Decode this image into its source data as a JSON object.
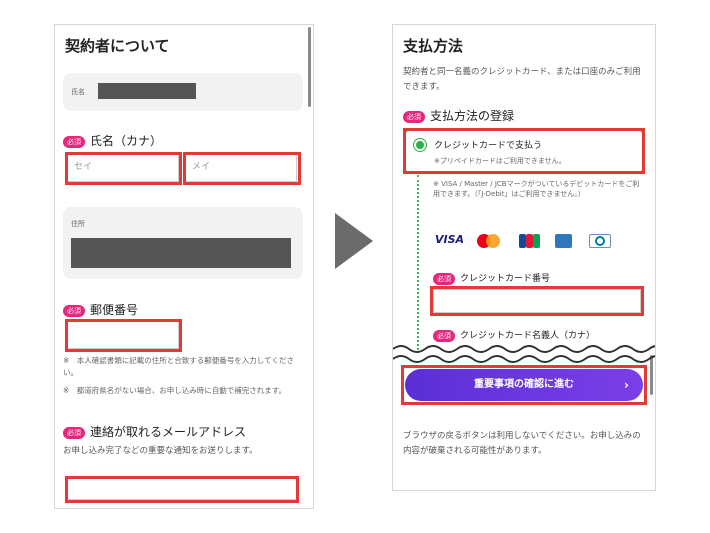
{
  "left": {
    "title": "契約者について",
    "name_label": "氏名",
    "required_badge": "必須",
    "kana_label": "氏名（カナ）",
    "sei_placeholder": "セイ",
    "mei_placeholder": "メイ",
    "address_label": "住所",
    "postal_label": "郵便番号",
    "postal_note1": "※　本人確認書類に記載の住所と合致する郵便番号を入力してください。",
    "postal_note2": "※　都道府県名がない場合、お申し込み時に自動で補完されます。",
    "email_label": "連絡が取れるメールアドレス",
    "email_desc": "お申し込み完了などの重要な通知をお送りします。"
  },
  "right": {
    "title": "支払方法",
    "desc": "契約者と同一名義のクレジットカード、または口座のみご利用できます。",
    "required_badge": "必須",
    "register_label": "支払方法の登録",
    "option_label": "クレジットカードで支払う",
    "option_note": "※プリペイドカードはご利用できません。",
    "debit_note": "※ VISA / Master / JCBマークがついているデビットカードをご利用できます。（「J-Debit」はご利用できません。）",
    "card_logos": [
      "VISA",
      "Mastercard",
      "JCB",
      "AMEX",
      "Diners Club"
    ],
    "card_number_label": "クレジットカード番号",
    "card_holder_label": "クレジットカード名義人（カナ）",
    "cta_label": "重要事項の確認に進む",
    "footer_note": "ブラウザの戻るボタンは利用しないでください。お申し込みの内容が破棄される可能性があります。"
  },
  "colors": {
    "highlight": "#e53935",
    "required": "#e8267c",
    "cta": "#6a35df",
    "selected": "#2ab04a"
  }
}
